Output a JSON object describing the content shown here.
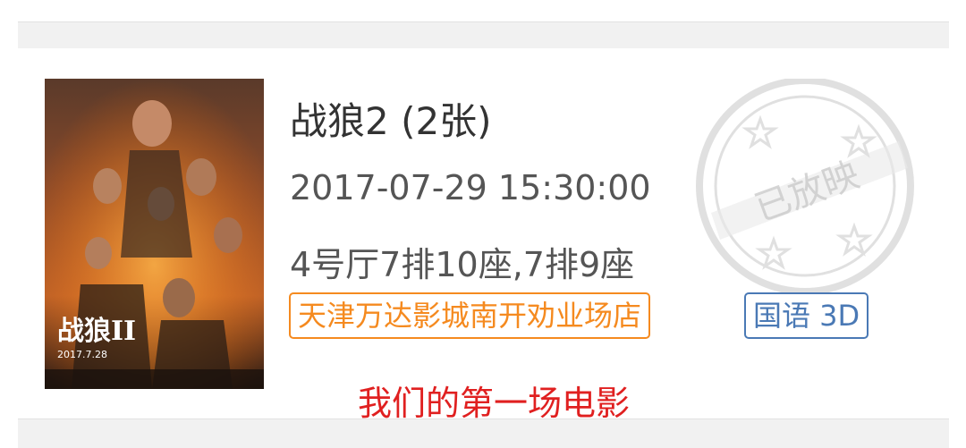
{
  "order": {
    "movie_title": "战狼2 (2张)",
    "showtime": "2017-07-29 15:30:00",
    "seats": "4号厅7排10座,7排9座",
    "cinema": "天津万达影城南开劝业场店",
    "format": "国语 3D",
    "stamp_text": "已放映",
    "note": "我们的第一场电影"
  },
  "icons": {
    "poster": "movie-poster-image",
    "stamp": "shown-stamp-icon"
  },
  "colors": {
    "cinema_tag": "#f58a1f",
    "format_tag": "#4a79b5",
    "note_text": "#e02020",
    "stamp": "#c8c8c8"
  }
}
